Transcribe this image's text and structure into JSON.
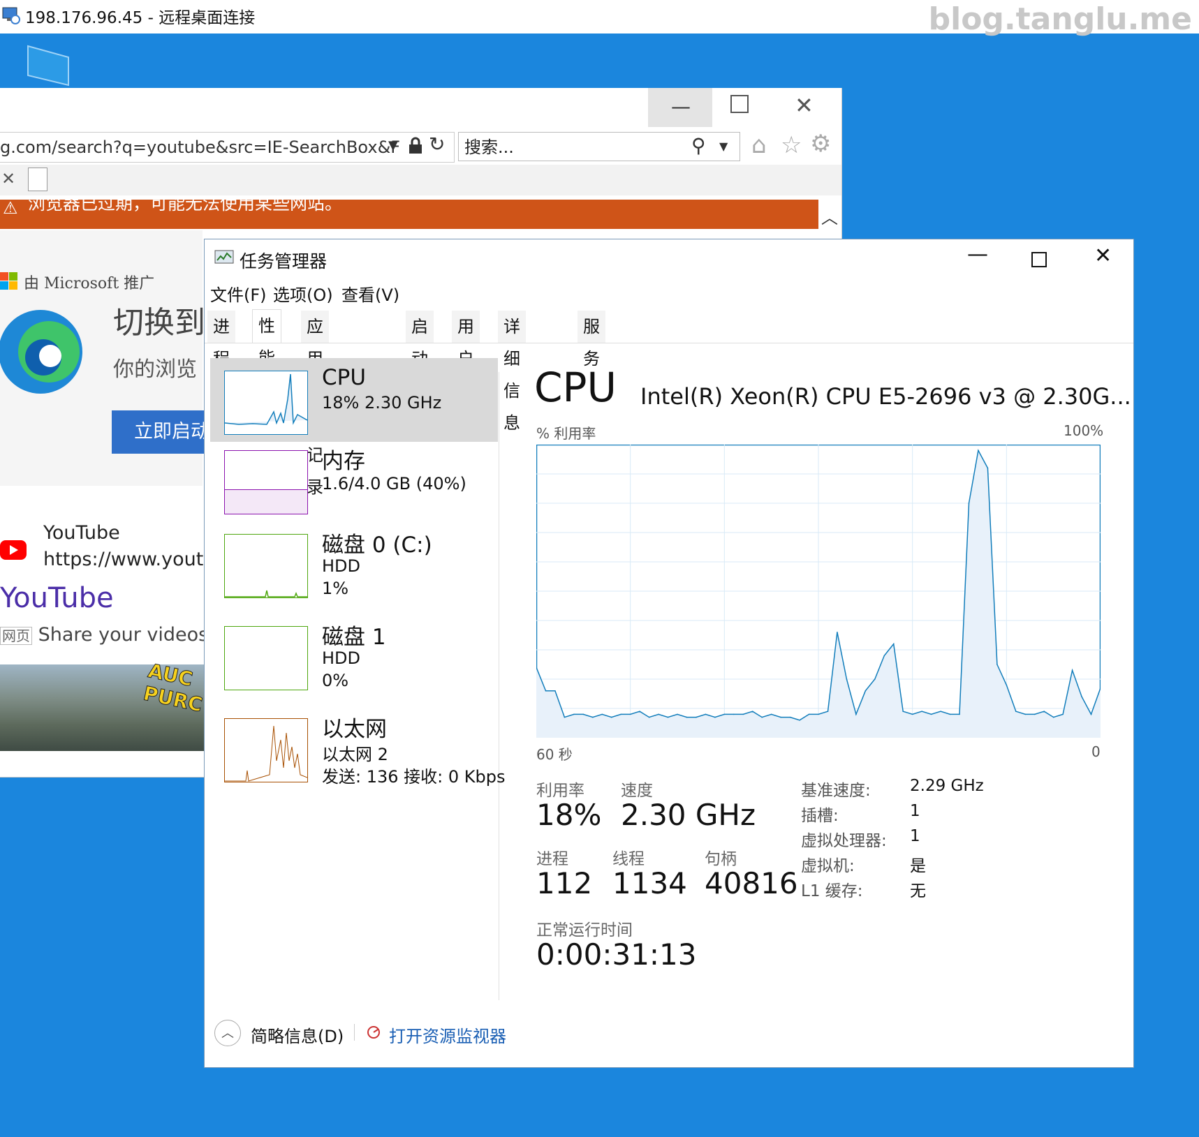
{
  "rdp": {
    "title": "198.176.96.45 - 远程桌面连接",
    "watermark": "blog.tanglu.me"
  },
  "browser": {
    "address": "g.com/search?q=youtube&src=IE-SearchBox&F",
    "search_placeholder": "搜索...",
    "warning": "浏览器已过期，可能无法使用某些网站。",
    "promo": "由 Microsoft 推广",
    "switch_title": "切换到",
    "browser_sub": "你的浏览",
    "launch_button": "立即启动",
    "result_name": "YouTube",
    "result_url": "https://www.youtub",
    "result_link": "YouTube",
    "result_tag": "网页",
    "result_snippet": "Share your videos w",
    "thumb_text": "AUC PURC"
  },
  "taskmgr": {
    "title": "任务管理器",
    "menu": [
      "文件(F)",
      "选项(O)",
      "查看(V)"
    ],
    "tabs": [
      "进程",
      "性能",
      "应用历史记录",
      "启动",
      "用户",
      "详细信息",
      "服务"
    ],
    "active_tab": "性能",
    "side_items": [
      {
        "name": "CPU",
        "line1": "18%  2.30 GHz",
        "line2": "",
        "line3": ""
      },
      {
        "name": "内存",
        "line1": "1.6/4.0 GB (40%)",
        "line2": "",
        "line3": ""
      },
      {
        "name": "磁盘 0 (C:)",
        "line1": "HDD",
        "line2": "1%",
        "line3": ""
      },
      {
        "name": "磁盘 1",
        "line1": "HDD",
        "line2": "0%",
        "line3": ""
      },
      {
        "name": "以太网",
        "line1": "以太网 2",
        "line2": "发送: 136  接收: 0 Kbps",
        "line3": ""
      }
    ],
    "heading": "CPU",
    "model": "Intel(R) Xeon(R) CPU E5-2696 v3 @ 2.30G...",
    "util_label": "% 利用率",
    "max_label": "100%",
    "x_left": "60 秒",
    "x_right": "0",
    "stats": {
      "util_label": "利用率",
      "util_value": "18%",
      "speed_label": "速度",
      "speed_value": "2.30 GHz",
      "proc_label": "进程",
      "proc_value": "112",
      "thread_label": "线程",
      "thread_value": "1134",
      "handle_label": "句柄",
      "handle_value": "40816",
      "uptime_label": "正常运行时间",
      "uptime_value": "0:00:31:13"
    },
    "specs": [
      {
        "k": "基准速度:",
        "v": "2.29 GHz"
      },
      {
        "k": "插槽:",
        "v": "1"
      },
      {
        "k": "虚拟处理器:",
        "v": "1"
      },
      {
        "k": "虚拟机:",
        "v": "是"
      },
      {
        "k": "L1 缓存:",
        "v": "无"
      }
    ],
    "footer_brief": "简略信息(D)",
    "footer_resmon": "打开资源监视器"
  },
  "colors": {
    "desktop": "#1b86dd",
    "warning": "#cf5418",
    "cpu_line": "#117dbb",
    "cpu_fill": "#e8f1fa",
    "mem_border": "#8b12ae",
    "disk_border": "#4da60c",
    "eth_border": "#a74f01"
  },
  "chart_data": {
    "type": "area",
    "title": "",
    "xlabel": "60 秒",
    "ylabel": "% 利用率",
    "x_range": [
      60,
      0
    ],
    "ylim": [
      0,
      100
    ],
    "x": [
      60,
      59,
      58,
      57,
      56,
      55,
      54,
      53,
      52,
      51,
      50,
      49,
      48,
      47,
      46,
      45,
      44,
      43,
      42,
      41,
      40,
      39,
      38,
      37,
      36,
      35,
      34,
      33,
      32,
      31,
      30,
      29,
      28,
      27,
      26,
      25,
      24,
      23,
      22,
      21,
      20,
      19,
      18,
      17,
      16,
      15,
      14,
      13,
      12,
      11,
      10,
      9,
      8,
      7,
      6,
      5,
      4,
      3,
      2,
      1,
      0
    ],
    "series": [
      {
        "values": [
          24,
          16,
          16,
          7,
          8,
          8,
          7,
          8,
          7,
          8,
          8,
          9,
          7,
          8,
          7,
          8,
          7,
          7,
          8,
          7,
          8,
          8,
          8,
          9,
          7,
          8,
          7,
          7,
          6,
          8,
          8,
          9,
          36,
          20,
          8,
          16,
          20,
          28,
          32,
          9,
          8,
          9,
          8,
          9,
          8,
          8,
          80,
          98,
          92,
          25,
          18,
          9,
          8,
          8,
          9,
          7,
          8,
          23,
          14,
          8,
          17
        ]
      }
    ]
  }
}
